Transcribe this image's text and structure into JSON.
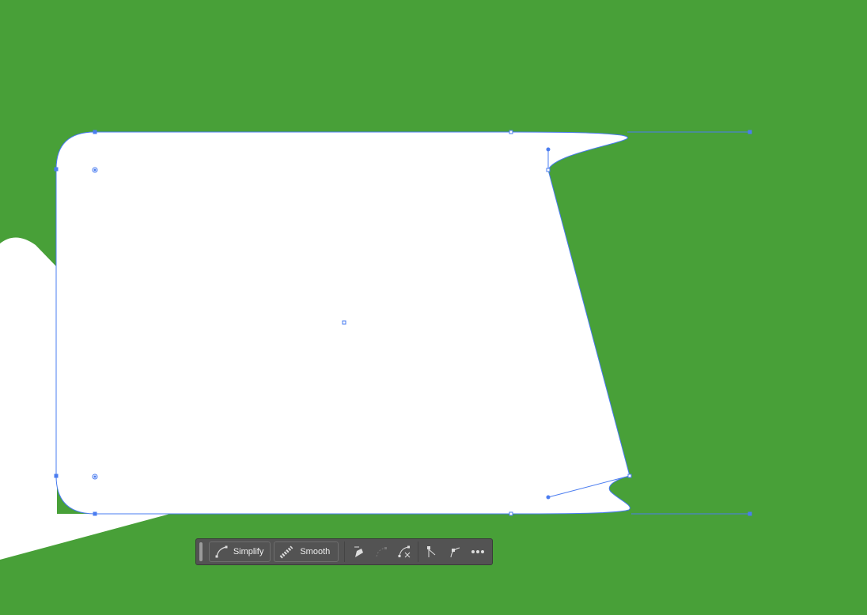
{
  "taskbar": {
    "simplify_label": "Simplify",
    "smooth_label": "Smooth",
    "icons": [
      "pen-icon",
      "connect-paths-icon",
      "cut-path-icon",
      "corner-anchor-icon",
      "smooth-anchor-icon",
      "more-icon"
    ]
  },
  "colors": {
    "background": "#48a038",
    "selection": "#4a7cf0",
    "shape_fill": "#ffffff",
    "taskbar": "#535353"
  }
}
